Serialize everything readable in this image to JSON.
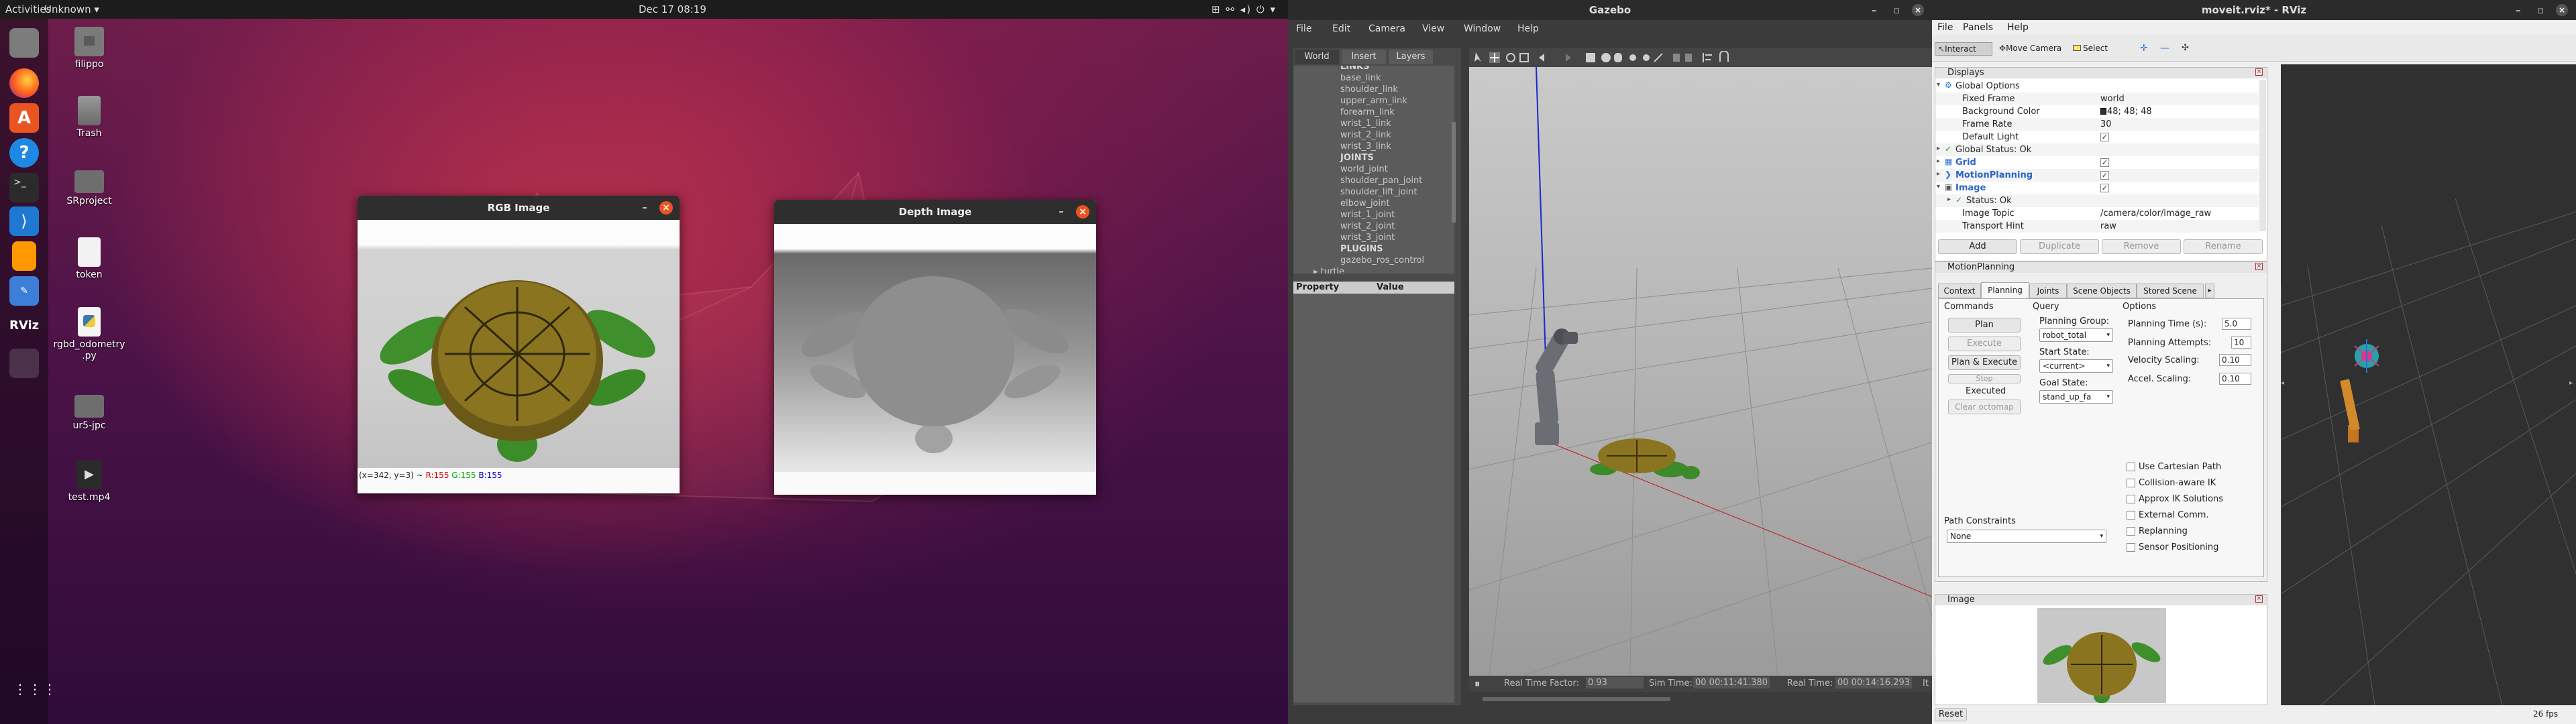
{
  "topbar": {
    "activities": "Activities",
    "app_menu": "Unknown ▾",
    "clock": "Dec 17  08:19",
    "tray": "⊞ ⚯ ◂) ⏻ ▾"
  },
  "dock": {
    "items": [
      "files-icon",
      "firefox-icon",
      "software-icon",
      "help-icon",
      "terminal-icon",
      "vscode-icon",
      "sublime-icon",
      "text-editor-icon",
      "rviz-icon",
      "active-app-icon"
    ],
    "apps_grid": "⋮⋮⋮"
  },
  "desktop_icons": [
    {
      "label": "filippo",
      "icon": "home-folder-icon"
    },
    {
      "label": "Trash",
      "icon": "trash-icon"
    },
    {
      "label": "SRproject",
      "icon": "folder-icon"
    },
    {
      "label": "token",
      "icon": "text-file-icon"
    },
    {
      "label": "rgbd_odometry\n.py",
      "icon": "python-file-icon"
    },
    {
      "label": "ur5-jpc",
      "icon": "folder-icon"
    },
    {
      "label": "test.mp4",
      "icon": "video-file-icon"
    }
  ],
  "rgb_window": {
    "title": "RGB Image",
    "status": "(x=342, y=3) ~ ",
    "r": "R:155",
    "g": "G:155",
    "b": "B:155"
  },
  "depth_window": {
    "title": "Depth Image"
  },
  "gazebo": {
    "title": "Gazebo",
    "menu": [
      "File",
      "Edit",
      "Camera",
      "View",
      "Window",
      "Help"
    ],
    "tabs": [
      "World",
      "Insert",
      "Layers"
    ],
    "tree": [
      "LINKS",
      "base_link",
      "shoulder_link",
      "upper_arm_link",
      "forearm_link",
      "wrist_1_link",
      "wrist_2_link",
      "wrist_3_link",
      "JOINTS",
      "world_joint",
      "shoulder_pan_joint",
      "shoulder_lift_joint",
      "elbow_joint",
      "wrist_1_joint",
      "wrist_2_joint",
      "wrist_3_joint",
      "PLUGINS",
      "gazebo_ros_control",
      "▸ turtle"
    ],
    "prop_headers": [
      "Property",
      "Value"
    ],
    "status": {
      "rtf_label": "Real Time Factor:",
      "rtf": "0.93",
      "sim_label": "Sim Time:",
      "sim": "00 00:11:41.380",
      "real_label": "Real Time:",
      "real": "00 00:14:16.293",
      "iter": "It"
    }
  },
  "rviz": {
    "title": "moveit.rviz* - RViz",
    "menu": [
      "File",
      "Panels",
      "Help"
    ],
    "toolbar": [
      "Interact",
      "Move Camera",
      "Select"
    ],
    "displays": {
      "title": "Displays",
      "rows": [
        {
          "name": "Global Options",
          "value": ""
        },
        {
          "name": "Fixed Frame",
          "value": "world"
        },
        {
          "name": "Background Color",
          "value": "48; 48; 48"
        },
        {
          "name": "Frame Rate",
          "value": "30"
        },
        {
          "name": "Default Light",
          "value": ""
        },
        {
          "name": "Global Status: Ok",
          "value": ""
        },
        {
          "name": "Grid",
          "value": ""
        },
        {
          "name": "MotionPlanning",
          "value": ""
        },
        {
          "name": "Image",
          "value": ""
        },
        {
          "name": "Status: Ok",
          "value": ""
        },
        {
          "name": "Image Topic",
          "value": "/camera/color/image_raw"
        },
        {
          "name": "Transport Hint",
          "value": "raw"
        }
      ],
      "buttons": [
        "Add",
        "Duplicate",
        "Remove",
        "Rename"
      ]
    },
    "motion": {
      "title": "MotionPlanning",
      "tabs": [
        "Context",
        "Planning",
        "Joints",
        "Scene Objects",
        "Stored Scene"
      ],
      "commands_label": "Commands",
      "query_label": "Query",
      "options_label": "Options",
      "commands": [
        "Plan",
        "Execute",
        "Plan & Execute",
        "Stop",
        "Executed",
        "Clear octomap"
      ],
      "planning_group_label": "Planning Group:",
      "planning_group": "robot_total",
      "start_state_label": "Start State:",
      "start_state": "<current>",
      "goal_state_label": "Goal State:",
      "goal_state": "stand_up_fa",
      "opts": [
        {
          "label": "Planning Time (s):",
          "value": "5.0"
        },
        {
          "label": "Planning Attempts:",
          "value": "10"
        },
        {
          "label": "Velocity Scaling:",
          "value": "0.10"
        },
        {
          "label": "Accel. Scaling:",
          "value": "0.10"
        }
      ],
      "checks": [
        "Use Cartesian Path",
        "Collision-aware IK",
        "Approx IK Solutions",
        "External Comm.",
        "Replanning",
        "Sensor Positioning"
      ],
      "path_constraints_label": "Path Constraints",
      "path_constraints": "None"
    },
    "image_panel": {
      "title": "Image"
    },
    "bottom": {
      "reset": "Reset",
      "fps": "26 fps"
    }
  },
  "colors": {
    "accent": "#e95420",
    "rviz_bg": "#303030",
    "desktop": "#5a1447"
  }
}
